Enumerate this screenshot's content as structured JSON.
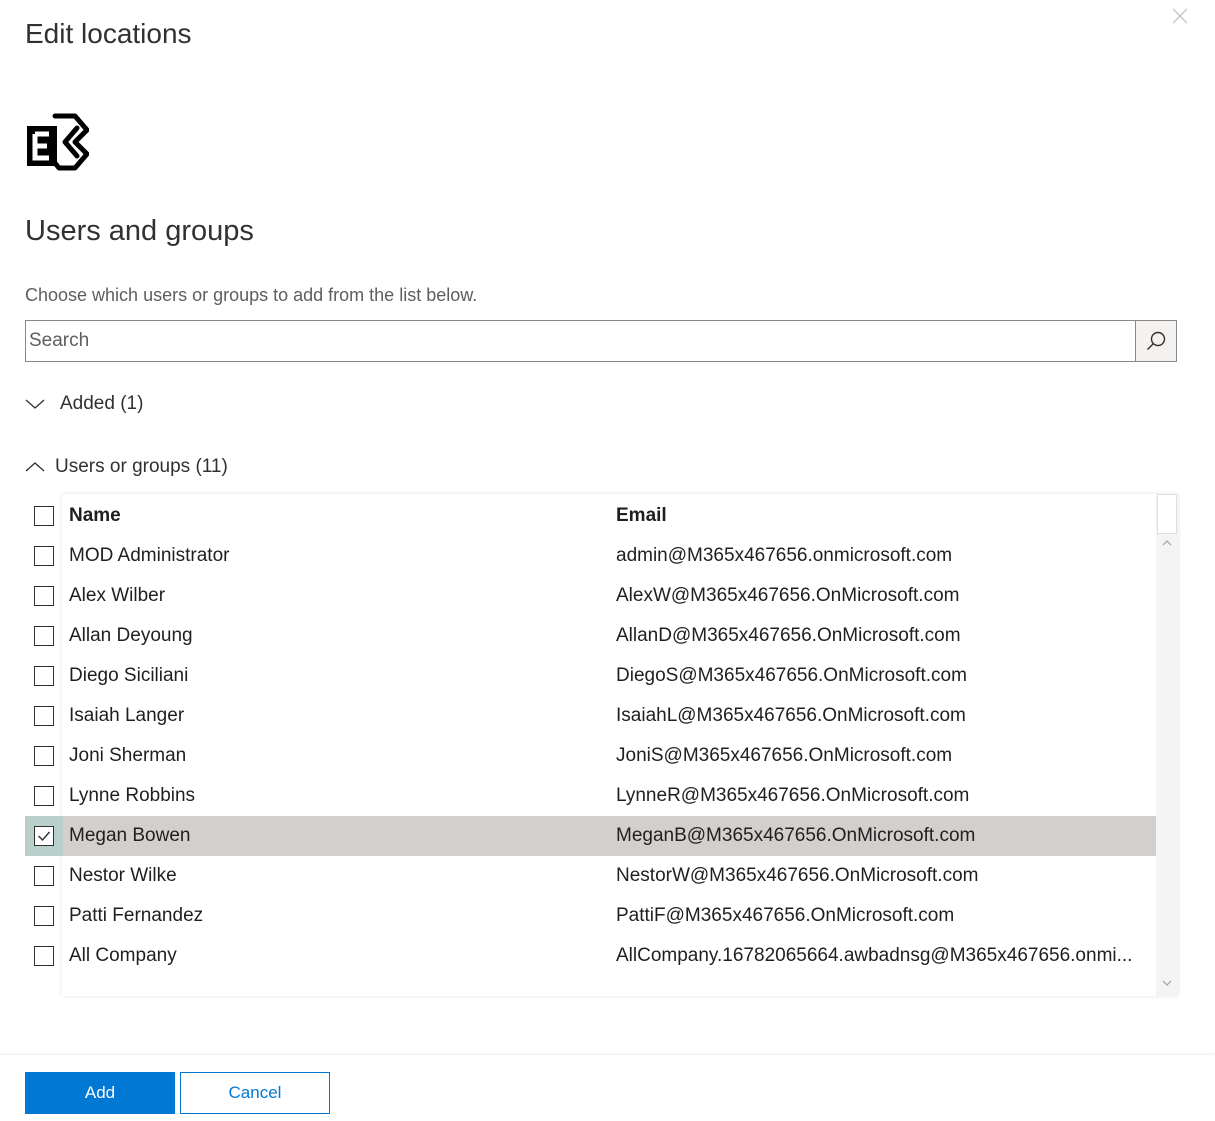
{
  "panel": {
    "title": "Edit locations",
    "close_icon": "close-icon"
  },
  "section": {
    "icon": "exchange-icon",
    "title": "Users and groups",
    "instructions": "Choose which users or groups to add from the list below."
  },
  "search": {
    "placeholder": "Search",
    "value": "",
    "icon": "search-icon"
  },
  "added_group": {
    "label": "Added (1)",
    "expanded": false,
    "icon": "chevron-down-icon"
  },
  "users_group": {
    "label": "Users or groups (11)",
    "expanded": true,
    "icon": "chevron-up-icon"
  },
  "table": {
    "columns": [
      "Name",
      "Email"
    ],
    "rows": [
      {
        "name": "MOD Administrator",
        "email": "admin@M365x467656.onmicrosoft.com",
        "checked": false
      },
      {
        "name": "Alex Wilber",
        "email": "AlexW@M365x467656.OnMicrosoft.com",
        "checked": false
      },
      {
        "name": "Allan Deyoung",
        "email": "AllanD@M365x467656.OnMicrosoft.com",
        "checked": false
      },
      {
        "name": "Diego Siciliani",
        "email": "DiegoS@M365x467656.OnMicrosoft.com",
        "checked": false
      },
      {
        "name": "Isaiah Langer",
        "email": "IsaiahL@M365x467656.OnMicrosoft.com",
        "checked": false
      },
      {
        "name": "Joni Sherman",
        "email": "JoniS@M365x467656.OnMicrosoft.com",
        "checked": false
      },
      {
        "name": "Lynne Robbins",
        "email": "LynneR@M365x467656.OnMicrosoft.com",
        "checked": false
      },
      {
        "name": "Megan Bowen",
        "email": "MeganB@M365x467656.OnMicrosoft.com",
        "checked": true
      },
      {
        "name": "Nestor Wilke",
        "email": "NestorW@M365x467656.OnMicrosoft.com",
        "checked": false
      },
      {
        "name": "Patti Fernandez",
        "email": "PattiF@M365x467656.OnMicrosoft.com",
        "checked": false
      },
      {
        "name": "All Company",
        "email": "AllCompany.16782065664.awbadnsg@M365x467656.onmi...",
        "checked": false
      }
    ]
  },
  "footer": {
    "add_label": "Add",
    "cancel_label": "Cancel"
  },
  "colors": {
    "accent": "#0078d4",
    "selected_row": "#d2d0ce",
    "selected_checkbox_cell": "#b9cfcc"
  }
}
